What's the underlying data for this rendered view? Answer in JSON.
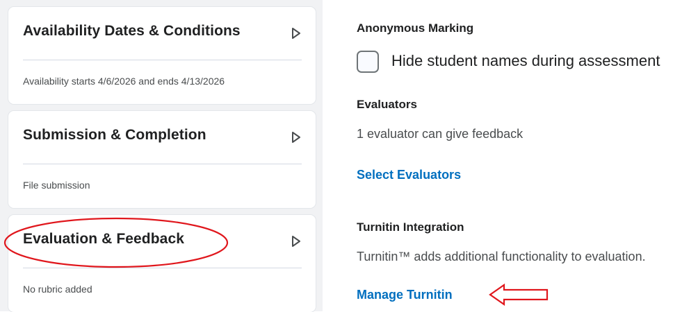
{
  "cards": [
    {
      "title": "Availability Dates & Conditions",
      "summary": "Availability starts 4/6/2026 and ends 4/13/2026"
    },
    {
      "title": "Submission & Completion",
      "summary": "File submission"
    },
    {
      "title": "Evaluation & Feedback",
      "summary": "No rubric added"
    }
  ],
  "anonymous": {
    "heading": "Anonymous Marking",
    "checkbox_label": "Hide student names during assessment",
    "checked": false
  },
  "evaluators": {
    "heading": "Evaluators",
    "description": "1 evaluator can give feedback",
    "link": "Select Evaluators"
  },
  "turnitin": {
    "heading": "Turnitin Integration",
    "description": "Turnitin™ adds additional functionality to evaluation.",
    "link": "Manage Turnitin"
  },
  "colors": {
    "link": "#006fbf",
    "annotation": "#e0161c",
    "panel_background": "#f1f2f4"
  },
  "icons": {
    "card_toggle": "chevron-right-icon",
    "annotation_arrow": "left-arrow-annotation"
  }
}
